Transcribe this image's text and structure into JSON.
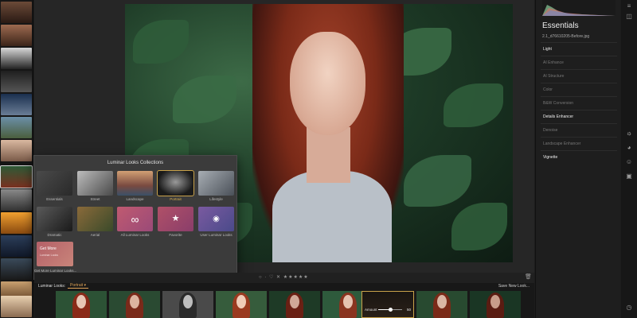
{
  "looks_popup": {
    "title": "Luminar Looks Collections",
    "items": [
      {
        "label": "Essentials"
      },
      {
        "label": "Street"
      },
      {
        "label": "Landscape"
      },
      {
        "label": "Portrait"
      },
      {
        "label": "Lifestyle"
      },
      {
        "label": "Dramatic"
      },
      {
        "label": "Aerial"
      },
      {
        "label": "All Luminar Looks"
      },
      {
        "label": "Favorite"
      },
      {
        "label": "User Luminar Looks"
      }
    ],
    "get_more": {
      "title": "Get More",
      "subtitle": "Luminar Looks",
      "label": "Get More Luminar Looks..."
    }
  },
  "bottom_bar": {
    "rating_glyphs": "○ · ♡ ✕ ★★★★★",
    "looks_label": "Luminar Looks:",
    "collection_value": "Portrait ▾",
    "save_label": "Save New Look...",
    "amount_label": "Amount",
    "amount_value": 50
  },
  "essentials": {
    "title": "Essentials",
    "filename": "2.1_d76610205-Before.jpg",
    "tools": [
      {
        "label": "Light",
        "active": true
      },
      {
        "label": "AI Enhance",
        "active": false
      },
      {
        "label": "AI Structure",
        "active": false
      },
      {
        "label": "Color",
        "active": false
      },
      {
        "label": "B&W Conversion",
        "active": false
      },
      {
        "label": "Details Enhancer",
        "active": true
      },
      {
        "label": "Denoise",
        "active": false
      },
      {
        "label": "Landscape Enhancer",
        "active": false
      },
      {
        "label": "Vignette",
        "active": true
      }
    ]
  },
  "icons": {
    "layers": "layers-icon",
    "compare": "compare-icon",
    "essentials": "sun-icon",
    "creative": "palette-icon",
    "portrait": "face-icon",
    "pro": "pro-icon",
    "history": "history-icon"
  },
  "colors": {
    "accent": "#e0a458",
    "selection": "#c9a24a"
  }
}
